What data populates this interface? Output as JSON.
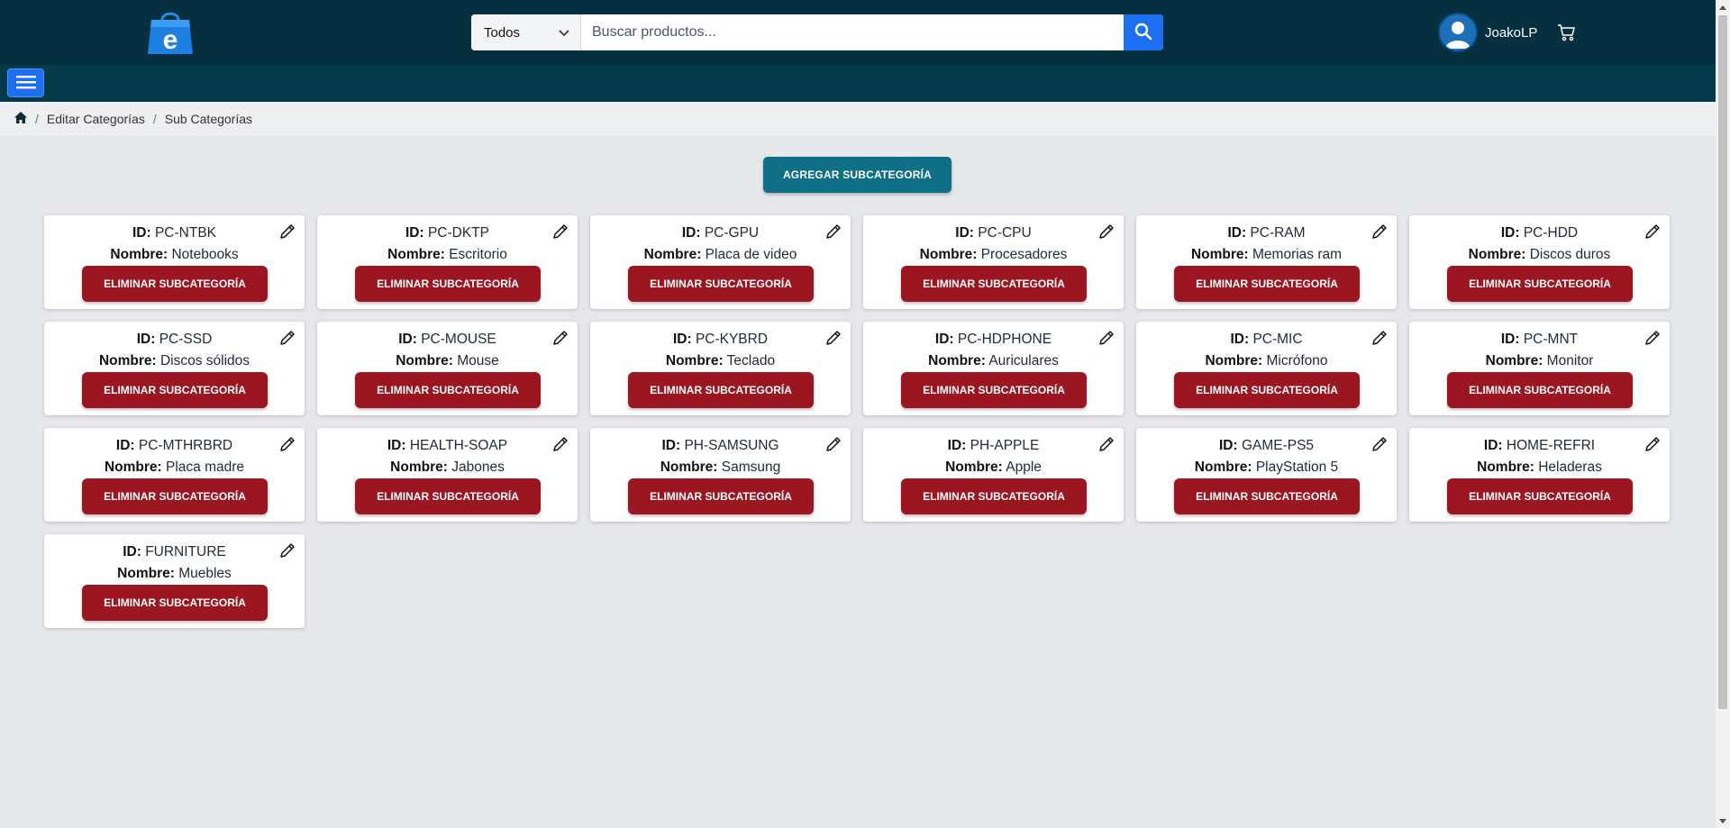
{
  "header": {
    "logo_icon": "shopping-bag-e-logo",
    "search": {
      "category_selected": "Todos",
      "placeholder": "Buscar productos...",
      "value": ""
    },
    "user": {
      "name": "JoakoLP",
      "avatar_icon": "user-avatar-icon"
    },
    "cart_icon": "cart-icon"
  },
  "navbar": {
    "menu_icon": "hamburger-menu-icon"
  },
  "breadcrumb": {
    "home_icon": "home-icon",
    "items": [
      "Editar Categorías",
      "Sub Categorías"
    ]
  },
  "main": {
    "add_button": "AGREGAR SUBCATEGORÍA",
    "id_label": "ID:",
    "name_label": "Nombre:",
    "delete_label": "ELIMINAR SUBCATEGORÍA",
    "cards": [
      {
        "id": "PC-NTBK",
        "name": "Notebooks"
      },
      {
        "id": "PC-DKTP",
        "name": "Escritorio"
      },
      {
        "id": "PC-GPU",
        "name": "Placa de video"
      },
      {
        "id": "PC-CPU",
        "name": "Procesadores"
      },
      {
        "id": "PC-RAM",
        "name": "Memorias ram"
      },
      {
        "id": "PC-HDD",
        "name": "Discos duros"
      },
      {
        "id": "PC-SSD",
        "name": "Discos sólidos"
      },
      {
        "id": "PC-MOUSE",
        "name": "Mouse"
      },
      {
        "id": "PC-KYBRD",
        "name": "Teclado"
      },
      {
        "id": "PC-HDPHONE",
        "name": "Auriculares"
      },
      {
        "id": "PC-MIC",
        "name": "Micrófono"
      },
      {
        "id": "PC-MNT",
        "name": "Monitor"
      },
      {
        "id": "PC-MTHRBRD",
        "name": "Placa madre"
      },
      {
        "id": "HEALTH-SOAP",
        "name": "Jabones"
      },
      {
        "id": "PH-SAMSUNG",
        "name": "Samsung"
      },
      {
        "id": "PH-APPLE",
        "name": "Apple"
      },
      {
        "id": "GAME-PS5",
        "name": "PlayStation 5"
      },
      {
        "id": "HOME-REFRI",
        "name": "Heladeras"
      },
      {
        "id": "FURNITURE",
        "name": "Muebles"
      }
    ]
  },
  "colors": {
    "header_bg": "#06303f",
    "navbar_bg": "#043a4a",
    "accent_blue": "#1d6ff2",
    "add_button": "#0e6f87",
    "delete_button": "#9b1620",
    "page_bg": "#e5e7eb"
  }
}
